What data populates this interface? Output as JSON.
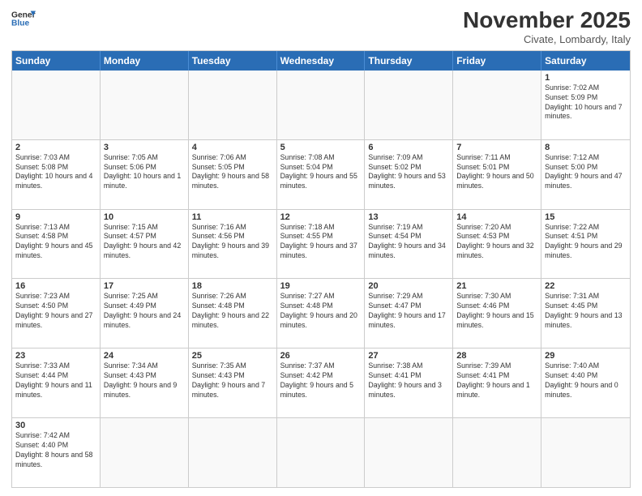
{
  "header": {
    "logo_general": "General",
    "logo_blue": "Blue",
    "month_title": "November 2025",
    "location": "Civate, Lombardy, Italy"
  },
  "days_of_week": [
    "Sunday",
    "Monday",
    "Tuesday",
    "Wednesday",
    "Thursday",
    "Friday",
    "Saturday"
  ],
  "weeks": [
    [
      {
        "day": "",
        "info": ""
      },
      {
        "day": "",
        "info": ""
      },
      {
        "day": "",
        "info": ""
      },
      {
        "day": "",
        "info": ""
      },
      {
        "day": "",
        "info": ""
      },
      {
        "day": "",
        "info": ""
      },
      {
        "day": "1",
        "info": "Sunrise: 7:02 AM\nSunset: 5:09 PM\nDaylight: 10 hours and 7 minutes."
      }
    ],
    [
      {
        "day": "2",
        "info": "Sunrise: 7:03 AM\nSunset: 5:08 PM\nDaylight: 10 hours and 4 minutes."
      },
      {
        "day": "3",
        "info": "Sunrise: 7:05 AM\nSunset: 5:06 PM\nDaylight: 10 hours and 1 minute."
      },
      {
        "day": "4",
        "info": "Sunrise: 7:06 AM\nSunset: 5:05 PM\nDaylight: 9 hours and 58 minutes."
      },
      {
        "day": "5",
        "info": "Sunrise: 7:08 AM\nSunset: 5:04 PM\nDaylight: 9 hours and 55 minutes."
      },
      {
        "day": "6",
        "info": "Sunrise: 7:09 AM\nSunset: 5:02 PM\nDaylight: 9 hours and 53 minutes."
      },
      {
        "day": "7",
        "info": "Sunrise: 7:11 AM\nSunset: 5:01 PM\nDaylight: 9 hours and 50 minutes."
      },
      {
        "day": "8",
        "info": "Sunrise: 7:12 AM\nSunset: 5:00 PM\nDaylight: 9 hours and 47 minutes."
      }
    ],
    [
      {
        "day": "9",
        "info": "Sunrise: 7:13 AM\nSunset: 4:58 PM\nDaylight: 9 hours and 45 minutes."
      },
      {
        "day": "10",
        "info": "Sunrise: 7:15 AM\nSunset: 4:57 PM\nDaylight: 9 hours and 42 minutes."
      },
      {
        "day": "11",
        "info": "Sunrise: 7:16 AM\nSunset: 4:56 PM\nDaylight: 9 hours and 39 minutes."
      },
      {
        "day": "12",
        "info": "Sunrise: 7:18 AM\nSunset: 4:55 PM\nDaylight: 9 hours and 37 minutes."
      },
      {
        "day": "13",
        "info": "Sunrise: 7:19 AM\nSunset: 4:54 PM\nDaylight: 9 hours and 34 minutes."
      },
      {
        "day": "14",
        "info": "Sunrise: 7:20 AM\nSunset: 4:53 PM\nDaylight: 9 hours and 32 minutes."
      },
      {
        "day": "15",
        "info": "Sunrise: 7:22 AM\nSunset: 4:51 PM\nDaylight: 9 hours and 29 minutes."
      }
    ],
    [
      {
        "day": "16",
        "info": "Sunrise: 7:23 AM\nSunset: 4:50 PM\nDaylight: 9 hours and 27 minutes."
      },
      {
        "day": "17",
        "info": "Sunrise: 7:25 AM\nSunset: 4:49 PM\nDaylight: 9 hours and 24 minutes."
      },
      {
        "day": "18",
        "info": "Sunrise: 7:26 AM\nSunset: 4:48 PM\nDaylight: 9 hours and 22 minutes."
      },
      {
        "day": "19",
        "info": "Sunrise: 7:27 AM\nSunset: 4:48 PM\nDaylight: 9 hours and 20 minutes."
      },
      {
        "day": "20",
        "info": "Sunrise: 7:29 AM\nSunset: 4:47 PM\nDaylight: 9 hours and 17 minutes."
      },
      {
        "day": "21",
        "info": "Sunrise: 7:30 AM\nSunset: 4:46 PM\nDaylight: 9 hours and 15 minutes."
      },
      {
        "day": "22",
        "info": "Sunrise: 7:31 AM\nSunset: 4:45 PM\nDaylight: 9 hours and 13 minutes."
      }
    ],
    [
      {
        "day": "23",
        "info": "Sunrise: 7:33 AM\nSunset: 4:44 PM\nDaylight: 9 hours and 11 minutes."
      },
      {
        "day": "24",
        "info": "Sunrise: 7:34 AM\nSunset: 4:43 PM\nDaylight: 9 hours and 9 minutes."
      },
      {
        "day": "25",
        "info": "Sunrise: 7:35 AM\nSunset: 4:43 PM\nDaylight: 9 hours and 7 minutes."
      },
      {
        "day": "26",
        "info": "Sunrise: 7:37 AM\nSunset: 4:42 PM\nDaylight: 9 hours and 5 minutes."
      },
      {
        "day": "27",
        "info": "Sunrise: 7:38 AM\nSunset: 4:41 PM\nDaylight: 9 hours and 3 minutes."
      },
      {
        "day": "28",
        "info": "Sunrise: 7:39 AM\nSunset: 4:41 PM\nDaylight: 9 hours and 1 minute."
      },
      {
        "day": "29",
        "info": "Sunrise: 7:40 AM\nSunset: 4:40 PM\nDaylight: 9 hours and 0 minutes."
      }
    ],
    [
      {
        "day": "30",
        "info": "Sunrise: 7:42 AM\nSunset: 4:40 PM\nDaylight: 8 hours and 58 minutes."
      },
      {
        "day": "",
        "info": ""
      },
      {
        "day": "",
        "info": ""
      },
      {
        "day": "",
        "info": ""
      },
      {
        "day": "",
        "info": ""
      },
      {
        "day": "",
        "info": ""
      },
      {
        "day": "",
        "info": ""
      }
    ]
  ]
}
